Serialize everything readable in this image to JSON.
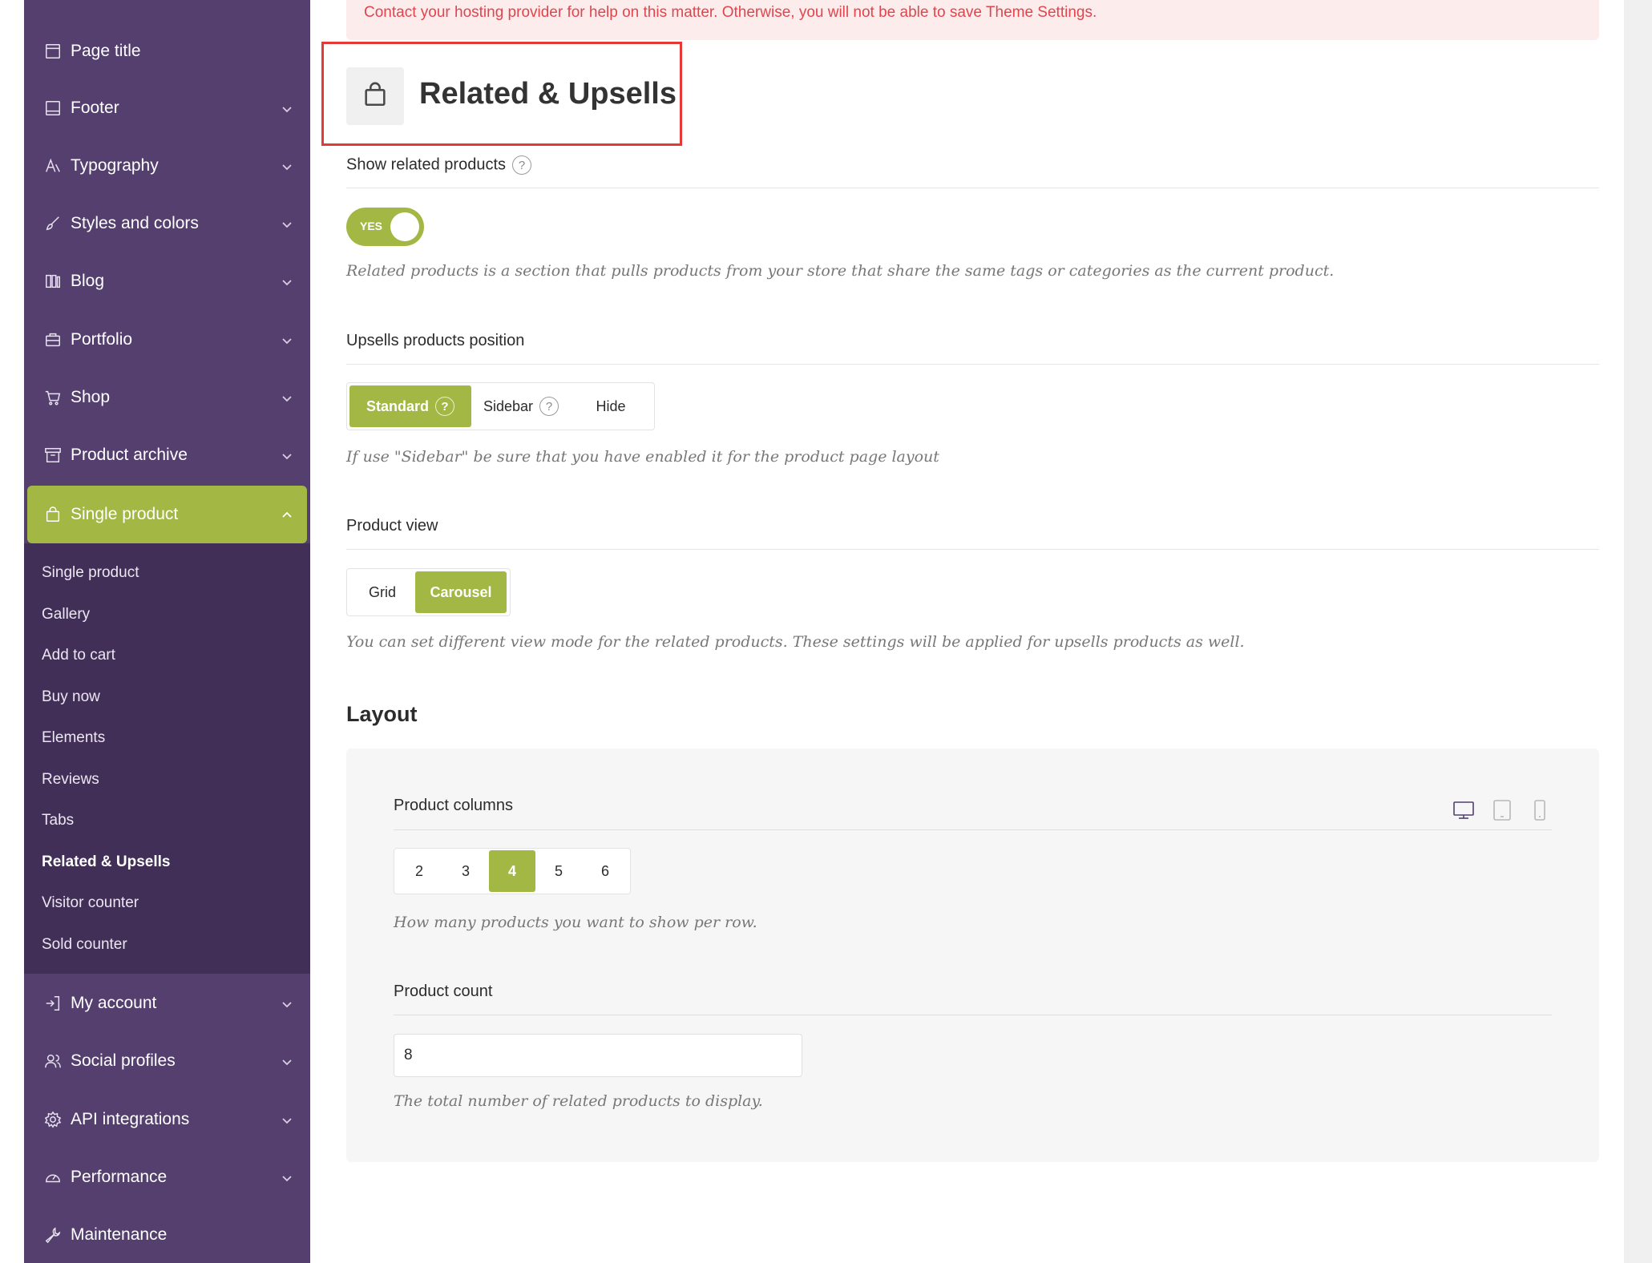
{
  "notice": "Contact your hosting provider for help on this matter. Otherwise, you will not be able to save Theme Settings.",
  "sidebar": {
    "items": [
      {
        "label": "Page title",
        "icon": "page-icon",
        "has_chevron": false
      },
      {
        "label": "Footer",
        "icon": "footer-icon",
        "has_chevron": true
      },
      {
        "label": "Typography",
        "icon": "typography-icon",
        "has_chevron": true
      },
      {
        "label": "Styles and colors",
        "icon": "brush-icon",
        "has_chevron": true
      },
      {
        "label": "Blog",
        "icon": "blog-icon",
        "has_chevron": true
      },
      {
        "label": "Portfolio",
        "icon": "briefcase-icon",
        "has_chevron": true
      },
      {
        "label": "Shop",
        "icon": "cart-icon",
        "has_chevron": true
      },
      {
        "label": "Product archive",
        "icon": "archive-icon",
        "has_chevron": true
      },
      {
        "label": "Single product",
        "icon": "bag-icon",
        "has_chevron": true,
        "active": true
      },
      {
        "label": "My account",
        "icon": "login-icon",
        "has_chevron": true
      },
      {
        "label": "Social profiles",
        "icon": "users-icon",
        "has_chevron": true
      },
      {
        "label": "API integrations",
        "icon": "gear-icon",
        "has_chevron": true
      },
      {
        "label": "Performance",
        "icon": "gauge-icon",
        "has_chevron": true
      },
      {
        "label": "Maintenance",
        "icon": "wrench-icon",
        "has_chevron": false
      }
    ],
    "submenu": [
      {
        "label": "Single product"
      },
      {
        "label": "Gallery"
      },
      {
        "label": "Add to cart"
      },
      {
        "label": "Buy now"
      },
      {
        "label": "Elements"
      },
      {
        "label": "Reviews"
      },
      {
        "label": "Tabs"
      },
      {
        "label": "Related & Upsells",
        "current": true
      },
      {
        "label": "Visitor counter"
      },
      {
        "label": "Sold counter"
      }
    ]
  },
  "page": {
    "title": "Related & Upsells",
    "title_icon": "bag-icon"
  },
  "related": {
    "label": "Show related products",
    "help": "?",
    "toggle_label": "YES",
    "toggle_on": true,
    "desc": "Related products is a section that pulls products from your store that share the same tags or categories as the current product."
  },
  "upsells": {
    "label": "Upsells products position",
    "options": [
      "Standard",
      "Sidebar",
      "Hide"
    ],
    "selected": "Standard",
    "help": "?",
    "desc": "If use \"Sidebar\" be sure that you have enabled it for the product page layout"
  },
  "view": {
    "label": "Product view",
    "options": [
      "Grid",
      "Carousel"
    ],
    "selected": "Carousel",
    "desc": "You can set different view mode for the related products. These settings will be applied for upsells products as well."
  },
  "layout": {
    "heading": "Layout",
    "columns": {
      "label": "Product columns",
      "options": [
        "2",
        "3",
        "4",
        "5",
        "6"
      ],
      "selected": "4",
      "desc": "How many products you want to show per row.",
      "devices": [
        "desktop-icon",
        "tablet-icon",
        "mobile-icon"
      ],
      "active_device": "desktop-icon"
    },
    "count": {
      "label": "Product count",
      "value": "8",
      "desc": "The total number of related products to display."
    }
  },
  "colors": {
    "sidebar": "#543f6e",
    "submenu": "#422f58",
    "accent": "#a3b744",
    "notice_bg": "#fdecec",
    "notice_text": "#e0454e",
    "highlight": "#e53935"
  }
}
